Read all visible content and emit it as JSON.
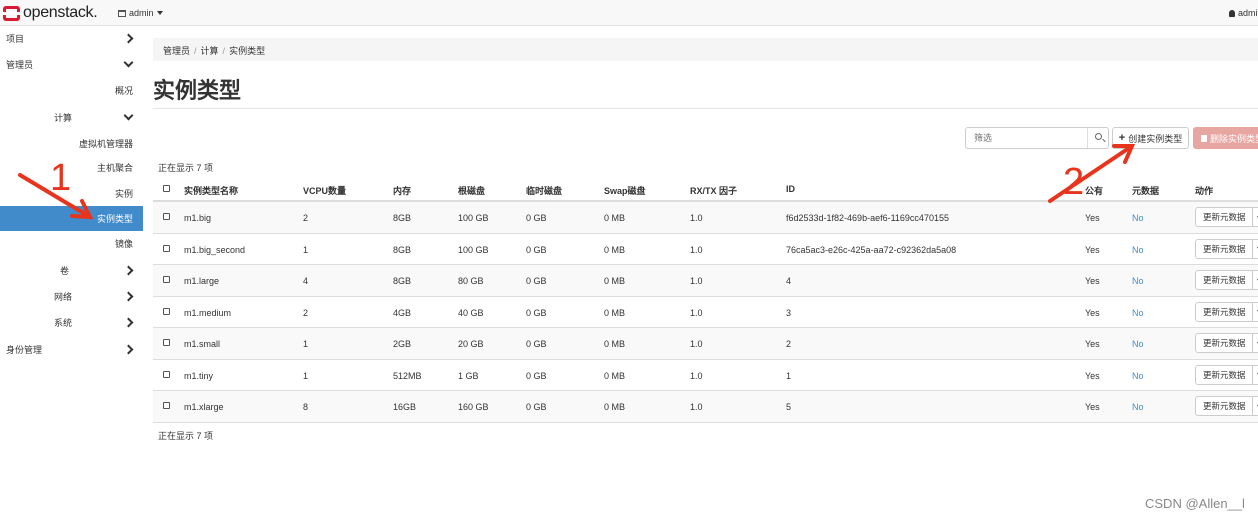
{
  "topbar": {
    "logo": "openstack.",
    "project_selector": "admin",
    "user_menu": "admi"
  },
  "sidebar": {
    "items": [
      {
        "label": "项目",
        "chevron": "right"
      },
      {
        "label": "管理员",
        "chevron": "down"
      },
      {
        "label": "概况"
      },
      {
        "label": "计算",
        "chevron": "down"
      },
      {
        "label": "虚拟机管理器"
      },
      {
        "label": "主机聚合"
      },
      {
        "label": "实例"
      },
      {
        "label": "实例类型",
        "active": true
      },
      {
        "label": "镜像"
      },
      {
        "label": "卷",
        "chevron": "right"
      },
      {
        "label": "网络",
        "chevron": "right"
      },
      {
        "label": "系统",
        "chevron": "right"
      },
      {
        "label": "身份管理",
        "chevron": "right"
      }
    ]
  },
  "breadcrumb": [
    "管理员",
    "计算",
    "实例类型"
  ],
  "page_title": "实例类型",
  "toolbar": {
    "filter_placeholder": "筛选",
    "create_label": "创建实例类型",
    "delete_label": "删除实例类型"
  },
  "count_text": "正在显示 7 项",
  "table": {
    "headers": [
      "实例类型名称",
      "VCPU数量",
      "内存",
      "根磁盘",
      "临时磁盘",
      "Swap磁盘",
      "RX/TX 因子",
      "ID",
      "公有",
      "元数据",
      "动作"
    ],
    "rows": [
      {
        "name": "m1.big",
        "vcpu": "2",
        "ram": "8GB",
        "root": "100 GB",
        "eph": "0 GB",
        "swap": "0 MB",
        "rxtx": "1.0",
        "id": "f6d2533d-1f82-469b-aef6-1169cc470155",
        "public": "Yes",
        "meta": "No",
        "action": "更新元数据"
      },
      {
        "name": "m1.big_second",
        "vcpu": "1",
        "ram": "8GB",
        "root": "100 GB",
        "eph": "0 GB",
        "swap": "0 MB",
        "rxtx": "1.0",
        "id": "76ca5ac3-e26c-425a-aa72-c92362da5a08",
        "public": "Yes",
        "meta": "No",
        "action": "更新元数据"
      },
      {
        "name": "m1.large",
        "vcpu": "4",
        "ram": "8GB",
        "root": "80 GB",
        "eph": "0 GB",
        "swap": "0 MB",
        "rxtx": "1.0",
        "id": "4",
        "public": "Yes",
        "meta": "No",
        "action": "更新元数据"
      },
      {
        "name": "m1.medium",
        "vcpu": "2",
        "ram": "4GB",
        "root": "40 GB",
        "eph": "0 GB",
        "swap": "0 MB",
        "rxtx": "1.0",
        "id": "3",
        "public": "Yes",
        "meta": "No",
        "action": "更新元数据"
      },
      {
        "name": "m1.small",
        "vcpu": "1",
        "ram": "2GB",
        "root": "20 GB",
        "eph": "0 GB",
        "swap": "0 MB",
        "rxtx": "1.0",
        "id": "2",
        "public": "Yes",
        "meta": "No",
        "action": "更新元数据"
      },
      {
        "name": "m1.tiny",
        "vcpu": "1",
        "ram": "512MB",
        "root": "1 GB",
        "eph": "0 GB",
        "swap": "0 MB",
        "rxtx": "1.0",
        "id": "1",
        "public": "Yes",
        "meta": "No",
        "action": "更新元数据"
      },
      {
        "name": "m1.xlarge",
        "vcpu": "8",
        "ram": "16GB",
        "root": "160 GB",
        "eph": "0 GB",
        "swap": "0 MB",
        "rxtx": "1.0",
        "id": "5",
        "public": "Yes",
        "meta": "No",
        "action": "更新元数据"
      }
    ]
  },
  "annotations": {
    "marker_1": "1",
    "marker_2": "2",
    "arrow_color": "#e8341c"
  },
  "watermark": "CSDN @Allen__l",
  "colors": {
    "active_nav": "#428bca",
    "link": "#428bca",
    "brand_red": "#da1a32",
    "delete_button": "#e8a6a2"
  }
}
